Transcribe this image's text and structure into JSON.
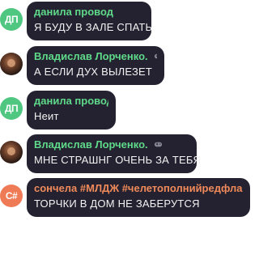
{
  "colors": {
    "bubble": "#242230",
    "name_green": "#5fd98a",
    "name_orange": "#f08a5a",
    "avatar_green": "#4fc780",
    "avatar_orange": "#ef7a56",
    "text": "#f2f2f2"
  },
  "messages": [
    {
      "author": "данила провод",
      "text": "Я БУДУ В ЗАЛЕ СПАТЬ",
      "avatar_initials": "ДП",
      "name_color": "#5fd98a",
      "avatar_color": "#4fc780"
    },
    {
      "author": "Владислав Лорченко.",
      "text": "А ЕСЛИ ДУХ ВЫЛЕЗЕТ",
      "avatar_icon": "user-photo",
      "badge_icon": "game-controller-icon",
      "name_color": "#5fd98a"
    },
    {
      "author": "данила провод",
      "text": "Неит",
      "avatar_initials": "ДП",
      "name_color": "#5fd98a",
      "avatar_color": "#4fc780"
    },
    {
      "author": "Владислав Лорченко.",
      "text": "МНЕ СТРАШНГ ОЧЕНЬ ЗА ТЕБЯ",
      "avatar_icon": "user-photo",
      "badge_icon": "game-controller-icon",
      "name_color": "#5fd98a"
    },
    {
      "author": "сончела #МЛДЖ #челетополнийредфла...",
      "text": "ТОРЧКИ В ДОМ НЕ ЗАБЕРУТСЯ",
      "avatar_initials": "С#",
      "name_color": "#f08a5a",
      "avatar_color": "#ef7a56"
    }
  ]
}
